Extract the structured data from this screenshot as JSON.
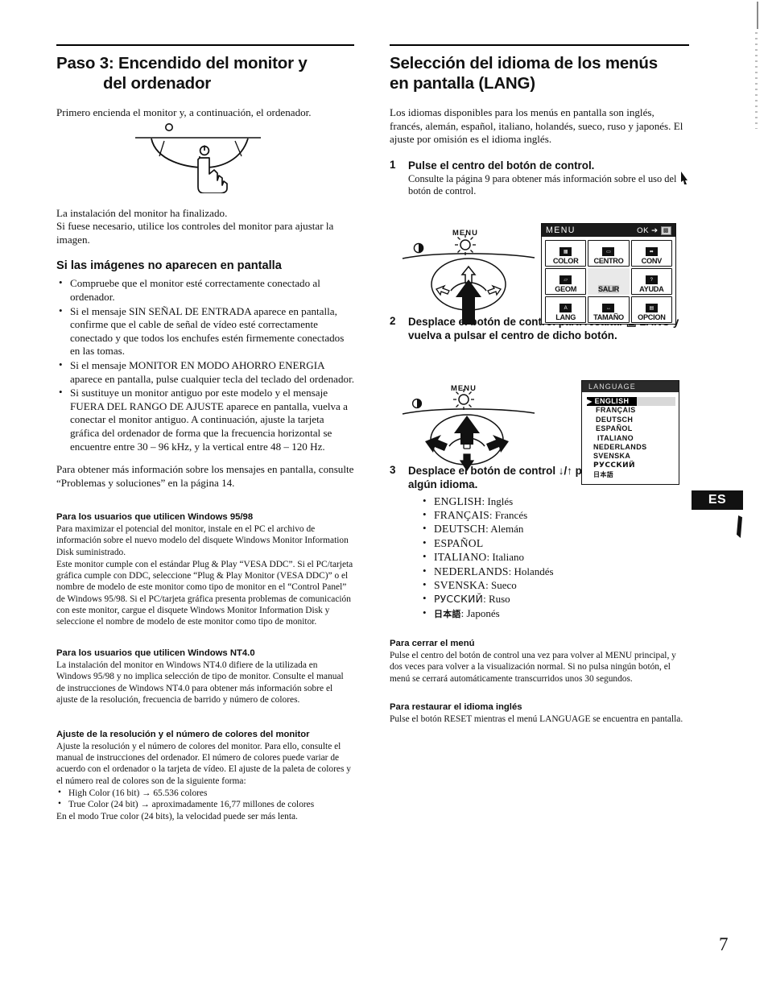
{
  "page": {
    "number": "7",
    "language_tab": "ES"
  },
  "left_column": {
    "heading_line1": "Paso 3: Encendido del monitor y",
    "heading_line2": "del ordenador",
    "intro": "Primero encienda el monitor y, a continuación, el ordenador.",
    "after_figure_line1": "La instalación del monitor ha finalizado.",
    "after_figure_line2": "Si fuese necesario, utilice los controles del monitor para ajustar la imagen.",
    "subheading_no_image": "Si las imágenes no aparecen en pantalla",
    "bullets": [
      "Compruebe que el monitor esté correctamente conectado al ordenador.",
      "Si el mensaje SIN SEÑAL DE ENTRADA aparece en pantalla, confirme que el cable de señal de vídeo esté correctamente conectado y que todos los enchufes estén firmemente conectados en las tomas.",
      "Si el mensaje MONITOR EN MODO AHORRO ENERGIA aparece en pantalla, pulse cualquier tecla del teclado del ordenador.",
      "Si sustituye un monitor antiguo por este modelo y el mensaje FUERA DEL RANGO DE AJUSTE aparece en pantalla, vuelva a conectar el monitor antiguo. A continuación, ajuste la tarjeta gráfica del ordenador de forma que la frecuencia horizontal se encuentre entre 30 – 96 kHz, y la vertical entre 48 – 120 Hz."
    ],
    "more_info": "Para obtener más información sobre los mensajes en pantalla, consulte “Problemas y soluciones” en la página 14.",
    "sections": [
      {
        "heading": "Para los usuarios que utilicen Windows 95/98",
        "paragraphs": [
          "Para maximizar el potencial del monitor, instale en el PC el archivo de información sobre el nuevo modelo del disquete Windows Monitor Information Disk suministrado.",
          "Este monitor cumple con el estándar Plug & Play “VESA DDC”. Si el PC/tarjeta gráfica cumple con DDC, seleccione “Plug & Play Monitor (VESA DDC)” o el nombre de modelo de este monitor como tipo de monitor en el “Control Panel” de Windows 95/98. Si el PC/tarjeta gráfica presenta problemas de comunicación con este monitor, cargue el disquete Windows Monitor Information Disk y seleccione el nombre de modelo de este monitor como tipo de monitor."
        ]
      },
      {
        "heading": "Para los usuarios que utilicen Windows NT4.0",
        "paragraphs": [
          "La instalación del monitor en Windows NT4.0 difiere de la utilizada en Windows 95/98 y no implica selección de tipo de monitor. Consulte el manual de instrucciones de Windows NT4.0 para obtener más información sobre el ajuste de la resolución, frecuencia de barrido y número de colores."
        ]
      },
      {
        "heading": "Ajuste de la resolución y el número de colores del monitor",
        "paragraphs": [
          "Ajuste la resolución y el número de colores del monitor. Para ello, consulte el manual de instrucciones del ordenador. El número de colores puede variar de acuerdo con el ordenador o la tarjeta de vídeo. El ajuste de la paleta de colores y el número real de colores son de la siguiente forma:"
        ],
        "bullets": [
          "High Color (16 bit) → 65.536 colores",
          "True Color (24 bit) → aproximadamente 16,77 millones de colores"
        ],
        "closing": "En el modo True color (24 bits), la velocidad puede ser más lenta."
      }
    ]
  },
  "right_column": {
    "heading_line1": "Selección del idioma de los menús",
    "heading_line2": "en pantalla (LANG)",
    "intro": "Los idiomas disponibles para los menús en pantalla son inglés, francés, alemán, español, italiano, holandés, sueco, ruso y japonés. El ajuste por omisión es el idioma inglés.",
    "steps": [
      {
        "num": "1",
        "title": "Pulse el centro del botón de control.",
        "body": "Consulte la página 9 para obtener más información sobre el uso del botón de control."
      },
      {
        "num": "2",
        "title": "Desplace el botón de control para resaltar ▣ LANG y vuelva a pulsar el centro de dicho botón.",
        "body": ""
      },
      {
        "num": "3",
        "title": "Desplace el botón de control ↓/↑ para seleccionar algún idioma.",
        "body": ""
      }
    ],
    "language_options": [
      {
        "code": "ENGLISH",
        "name": "Inglés"
      },
      {
        "code": "FRANÇAIS",
        "name": "Francés"
      },
      {
        "code": "DEUTSCH",
        "name": "Alemán"
      },
      {
        "code": "ESPAÑOL",
        "name": ""
      },
      {
        "code": "ITALIANO",
        "name": "Italiano"
      },
      {
        "code": "NEDERLANDS",
        "name": "Holandés"
      },
      {
        "code": "SVENSKA",
        "name": "Sueco"
      },
      {
        "code": "РУССКИЙ",
        "name": "Ruso"
      },
      {
        "code": "日本語",
        "name": "Japonés"
      }
    ],
    "sections": [
      {
        "heading": "Para cerrar el menú",
        "text": "Pulse el centro del botón de control una vez para volver al MENU principal, y dos veces para volver a la visualización normal. Si no pulsa ningún botón, el menú se cerrará automáticamente transcurridos unos 30 segundos."
      },
      {
        "heading": "Para restaurar el idioma inglés",
        "text": "Pulse el botón RESET mientras el menú LANGUAGE se encuentra en pantalla."
      }
    ]
  },
  "figures": {
    "control_button_label": "MENU",
    "osd_main": {
      "title": "MENU",
      "ok_label": "OK",
      "ok_icon": "⏎",
      "items": [
        {
          "label": "COLOR",
          "icon": "▦"
        },
        {
          "label": "CENTRO",
          "icon": "▭"
        },
        {
          "label": "CONV",
          "icon": "⬌"
        },
        {
          "label": "GEOM",
          "icon": "▱"
        },
        {
          "label": "SALIR",
          "icon": ""
        },
        {
          "label": "AYUDA",
          "icon": "?"
        },
        {
          "label": "LANG",
          "icon": "A"
        },
        {
          "label": "TAMAÑO",
          "icon": "↔"
        },
        {
          "label": "OPCION",
          "icon": "▤"
        }
      ],
      "selected": "SALIR"
    },
    "osd_language": {
      "title": "LANGUAGE",
      "items": [
        "ENGLISH",
        "FRANÇAIS",
        "DEUTSCH",
        "ESPAÑOL",
        "ITALIANO",
        "NEDERLANDS",
        "SVENSKA",
        "РУССКИЙ",
        "日本語"
      ],
      "selected": "ENGLISH"
    }
  }
}
